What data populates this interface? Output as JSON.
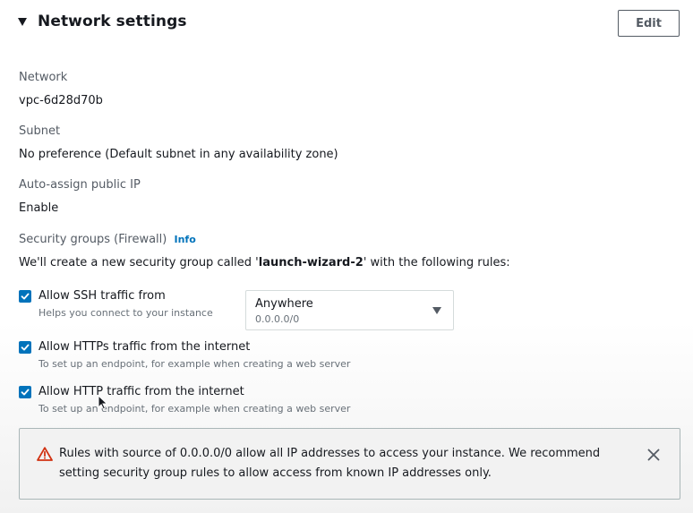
{
  "section": {
    "title": "Network settings",
    "edit_label": "Edit"
  },
  "network": {
    "label": "Network",
    "value": "vpc-6d28d70b"
  },
  "subnet": {
    "label": "Subnet",
    "value": "No preference (Default subnet in any availability zone)"
  },
  "public_ip": {
    "label": "Auto-assign public IP",
    "value": "Enable"
  },
  "security_groups": {
    "label": "Security groups (Firewall)",
    "info_link": "Info",
    "desc_prefix": "We'll create a new security group called '",
    "group_name": "launch-wizard-2",
    "desc_suffix": "' with the following rules:"
  },
  "rules": [
    {
      "label": "Allow SSH traffic from",
      "hint": "Helps you connect to your instance",
      "checked": true
    },
    {
      "label": "Allow HTTPs traffic from the internet",
      "hint": "To set up an endpoint, for example when creating a web server",
      "checked": true
    },
    {
      "label": "Allow HTTP traffic from the internet",
      "hint": "To set up an endpoint, for example when creating a web server",
      "checked": true
    }
  ],
  "ssh_source": {
    "value": "Anywhere",
    "sub": "0.0.0.0/0"
  },
  "warning": {
    "text": "Rules with source of 0.0.0.0/0 allow all IP addresses to access your instance. We recommend setting security group rules to allow access from known IP addresses only."
  },
  "colors": {
    "accent": "#0073bb",
    "warning_icon": "#d13212",
    "text": "#16191f",
    "muted": "#545b64"
  },
  "icons": {
    "caret": "caret-down-icon",
    "checkbox": "checkmark-icon",
    "dropdown": "dropdown-arrow-icon",
    "warning": "warning-triangle-icon",
    "close": "close-icon"
  }
}
